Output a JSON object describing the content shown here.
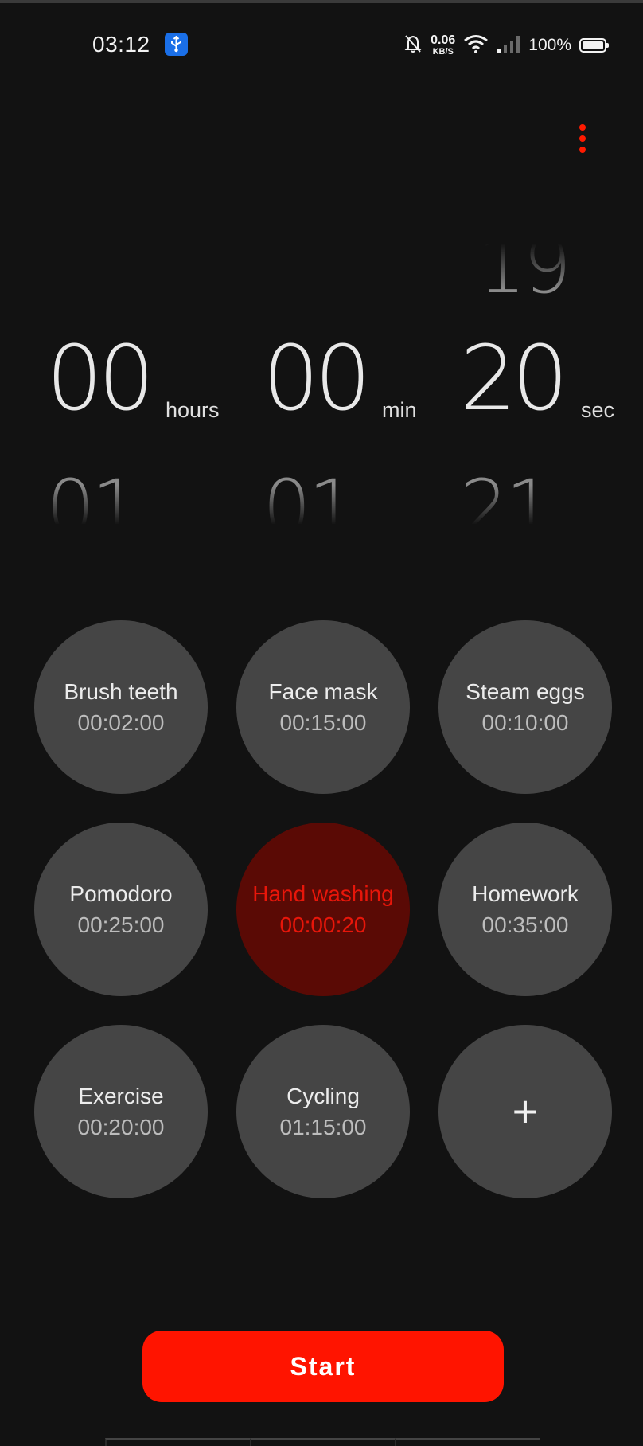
{
  "status_bar": {
    "time": "03:12",
    "net_speed_value": "0.06",
    "net_speed_unit": "KB/S",
    "battery_text": "100%",
    "icons": [
      "usb-icon",
      "bell-muted-icon",
      "wifi-icon",
      "signal-icon",
      "battery-icon"
    ]
  },
  "picker": {
    "hours": {
      "above": "",
      "value": "00",
      "below": "01",
      "unit": "hours"
    },
    "minutes": {
      "above": "",
      "value": "00",
      "below": "01",
      "unit": "min"
    },
    "seconds": {
      "above": "19",
      "value": "20",
      "below": "21",
      "unit": "sec"
    }
  },
  "presets": [
    {
      "name": "Brush teeth",
      "time": "00:02:00",
      "selected": false
    },
    {
      "name": "Face mask",
      "time": "00:15:00",
      "selected": false
    },
    {
      "name": "Steam eggs",
      "time": "00:10:00",
      "selected": false
    },
    {
      "name": "Pomodoro",
      "time": "00:25:00",
      "selected": false
    },
    {
      "name": "Hand washing",
      "time": "00:00:20",
      "selected": true
    },
    {
      "name": "Homework",
      "time": "00:35:00",
      "selected": false
    },
    {
      "name": "Exercise",
      "time": "00:20:00",
      "selected": false
    },
    {
      "name": "Cycling",
      "time": "01:15:00",
      "selected": false
    }
  ],
  "add_preset_label": "+",
  "start_label": "Start",
  "colors": {
    "accent": "#ff1400",
    "selected_bg": "#5a0a05",
    "preset_bg": "#454545",
    "background": "#121212"
  }
}
